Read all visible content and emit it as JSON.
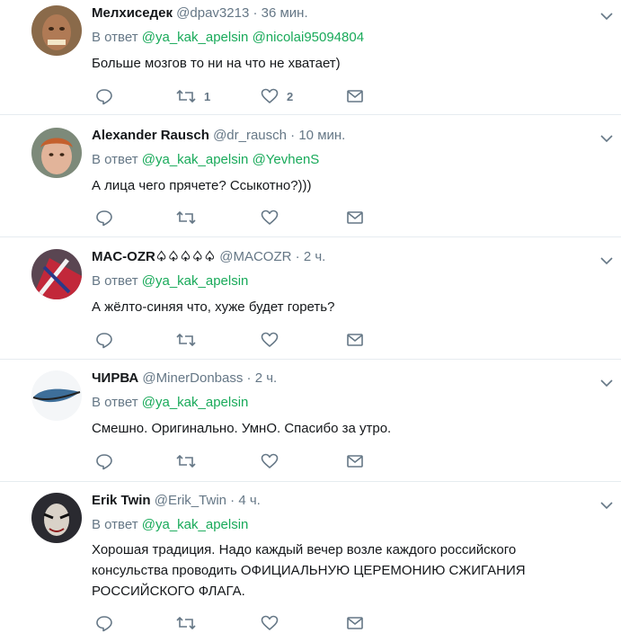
{
  "colors": {
    "mention": "#19aa5a",
    "muted": "#657786",
    "divider": "#e6ecf0"
  },
  "reply_prefix": "В ответ",
  "tweets": [
    {
      "name": "Мелхиседек",
      "handle": "@dpav3213",
      "sep": "·",
      "time": "36 мин.",
      "mentions": [
        "@ya_kak_apelsin",
        "@nicolai95094804"
      ],
      "text": "Больше мозгов то ни на что не хватает)",
      "retweets": "1",
      "likes": "2"
    },
    {
      "name": "Alexander Rausch",
      "handle": "@dr_rausch",
      "sep": "·",
      "time": "10 мин.",
      "mentions": [
        "@ya_kak_apelsin",
        "@YevhenS"
      ],
      "text": "А лица чего прячете? Ссыкотно?)))",
      "retweets": "",
      "likes": ""
    },
    {
      "name": "MAC-OZR♤♤♤♤♤",
      "handle": "@MACOZR",
      "sep": "·",
      "time": "2 ч.",
      "mentions": [
        "@ya_kak_apelsin"
      ],
      "text": "А жёлто-синяя что, хуже будет гореть?",
      "retweets": "",
      "likes": ""
    },
    {
      "name": "ЧИРВА",
      "handle": "@MinerDonbass",
      "sep": "·",
      "time": "2 ч.",
      "mentions": [
        "@ya_kak_apelsin"
      ],
      "text": "Смешно. Оригинально. УмнО. Спасибо за утро.",
      "retweets": "",
      "likes": ""
    },
    {
      "name": "Erik Twin",
      "handle": "@Erik_Twin",
      "sep": "·",
      "time": "4 ч.",
      "mentions": [
        "@ya_kak_apelsin"
      ],
      "text": "Хорошая традиция. Надо каждый вечер возле каждого российского консульства проводить ОФИЦИАЛЬНУЮ ЦЕРЕМОНИЮ СЖИГАНИЯ РОССИЙСКОГО ФЛАГА.",
      "retweets": "",
      "likes": ""
    }
  ]
}
